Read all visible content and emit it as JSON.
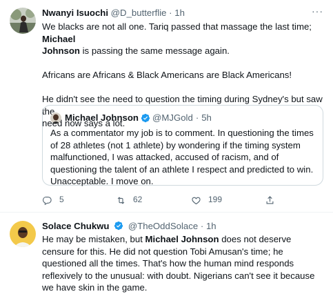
{
  "tweet1": {
    "name": "Nwanyi Isuochi",
    "handle": "@D_butterflie",
    "separator": "·",
    "time": "1h",
    "more": "···",
    "lines": {
      "l1": "We blacks are not all one. Tariq passed that massage the last time;",
      "l1_bold": "Michael",
      "l2_bold": "Johnson",
      "l2": "is passing the same message again.",
      "p2": "Africans are Africans & Black Americans are Black Americans!",
      "p3a": "He didn't see the need to question the timing during Sydney's but saw the",
      "p3b": "need now says a lot."
    },
    "quote": {
      "name": "Michael Johnson",
      "handle": "@MJGold",
      "separator": "·",
      "time": "5h",
      "text": "As a commentator my job is to comment. In questioning the times of 28 athletes (not 1 athlete) by wondering if the timing system malfunctioned, I was attacked, accused of racism, and of questioning the talent of an athlete I respect and predicted to win. Unacceptable. I move on."
    },
    "actions": {
      "replies": "5",
      "retweets": "62",
      "likes": "199"
    }
  },
  "tweet2": {
    "name": "Solace Chukwu",
    "handle": "@TheOddSolace",
    "separator": "·",
    "time": "1h",
    "text_a": "He may be mistaken, but",
    "text_bold": "Michael Johnson",
    "text_b": "does not deserve censure for this. He did not question Tobi Amusan's time; he questioned all the times. That's how the human mind responds reflexively to the unusual: with doubt. Nigerians can't see it because we have skin in the game."
  },
  "colors": {
    "text": "#0f1419",
    "muted": "#536471",
    "verified": "#1d9bf0",
    "border": "#cfd9de"
  }
}
